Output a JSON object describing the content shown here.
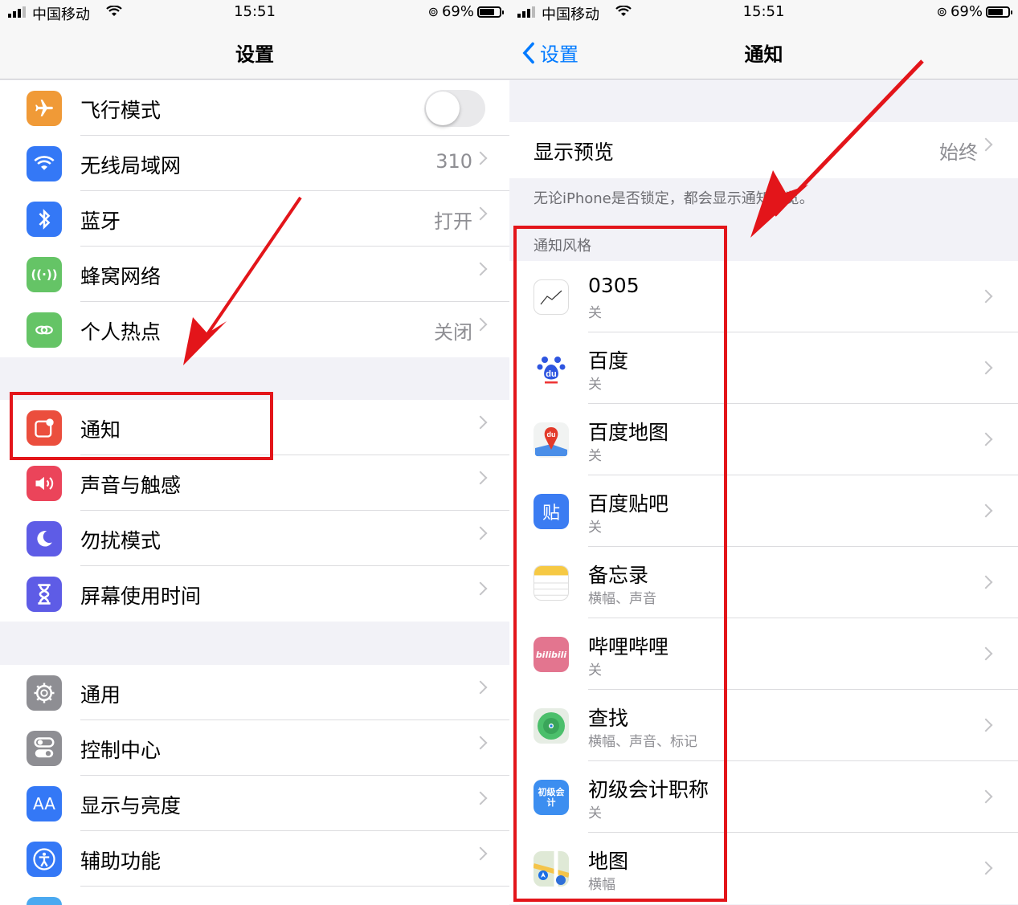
{
  "left": {
    "status": {
      "carrier": "中国移动",
      "time": "15:51",
      "battery": "69%"
    },
    "nav": {
      "title": "设置"
    },
    "group1": [
      {
        "label": "飞行模式",
        "icon": "airplane-icon",
        "color": "#f09a37",
        "toggle": "off"
      },
      {
        "label": "无线局域网",
        "value": "310",
        "icon": "wifi-icon",
        "color": "#3478f6"
      },
      {
        "label": "蓝牙",
        "value": "打开",
        "icon": "bluetooth-icon",
        "color": "#3478f6"
      },
      {
        "label": "蜂窝网络",
        "icon": "antenna-icon",
        "color": "#65c466"
      },
      {
        "label": "个人热点",
        "value": "关闭",
        "icon": "hotspot-icon",
        "color": "#65c466"
      }
    ],
    "group2": [
      {
        "label": "通知",
        "icon": "notification-icon",
        "color": "#eb4e3d"
      },
      {
        "label": "声音与触感",
        "icon": "speaker-icon",
        "color": "#eb445a"
      },
      {
        "label": "勿扰模式",
        "icon": "moon-icon",
        "color": "#5e5ce6"
      },
      {
        "label": "屏幕使用时间",
        "icon": "hourglass-icon",
        "color": "#5e5ce6"
      }
    ],
    "group3": [
      {
        "label": "通用",
        "icon": "gear-icon",
        "color": "#8e8e93"
      },
      {
        "label": "控制中心",
        "icon": "switches-icon",
        "color": "#8e8e93"
      },
      {
        "label": "显示与亮度",
        "icon": "aa-icon",
        "color": "#3478f6",
        "glyph": "AA"
      },
      {
        "label": "辅助功能",
        "icon": "accessibility-icon",
        "color": "#3478f6"
      }
    ]
  },
  "right": {
    "status": {
      "carrier": "中国移动",
      "time": "15:51",
      "battery": "69%"
    },
    "nav": {
      "back": "设置",
      "title": "通知"
    },
    "preview": {
      "label": "显示预览",
      "value": "始终"
    },
    "preview_note": "无论iPhone是否锁定，都会显示通知预览。",
    "section_header": "通知风格",
    "apps": [
      {
        "name": "0305",
        "sub": "关",
        "icon": "chart-app-icon",
        "color": "#ffffff",
        "glyph": ""
      },
      {
        "name": "百度",
        "sub": "关",
        "icon": "baidu-icon",
        "color": "#ffffff",
        "glyph": "du"
      },
      {
        "name": "百度地图",
        "sub": "关",
        "icon": "baidu-map-icon",
        "color": "#ffffff",
        "glyph": "du"
      },
      {
        "name": "百度贴吧",
        "sub": "关",
        "icon": "tieba-icon",
        "color": "#3b7cf2",
        "glyph": "贴"
      },
      {
        "name": "备忘录",
        "sub": "横幅、声音",
        "icon": "notes-icon",
        "color": "#ffffff",
        "glyph": ""
      },
      {
        "name": "哔哩哔哩",
        "sub": "关",
        "icon": "bilibili-icon",
        "color": "#e3758f",
        "glyph": "bilibili"
      },
      {
        "name": "查找",
        "sub": "横幅、声音、标记",
        "icon": "find-my-icon",
        "color": "#dfe9dd",
        "glyph": ""
      },
      {
        "name": "初级会计职称",
        "sub": "关",
        "icon": "accounting-app-icon",
        "color": "#3c8ef0",
        "glyph": "初级会计"
      },
      {
        "name": "地图",
        "sub": "横幅",
        "icon": "maps-icon",
        "color": "#ffffff",
        "glyph": ""
      }
    ]
  }
}
